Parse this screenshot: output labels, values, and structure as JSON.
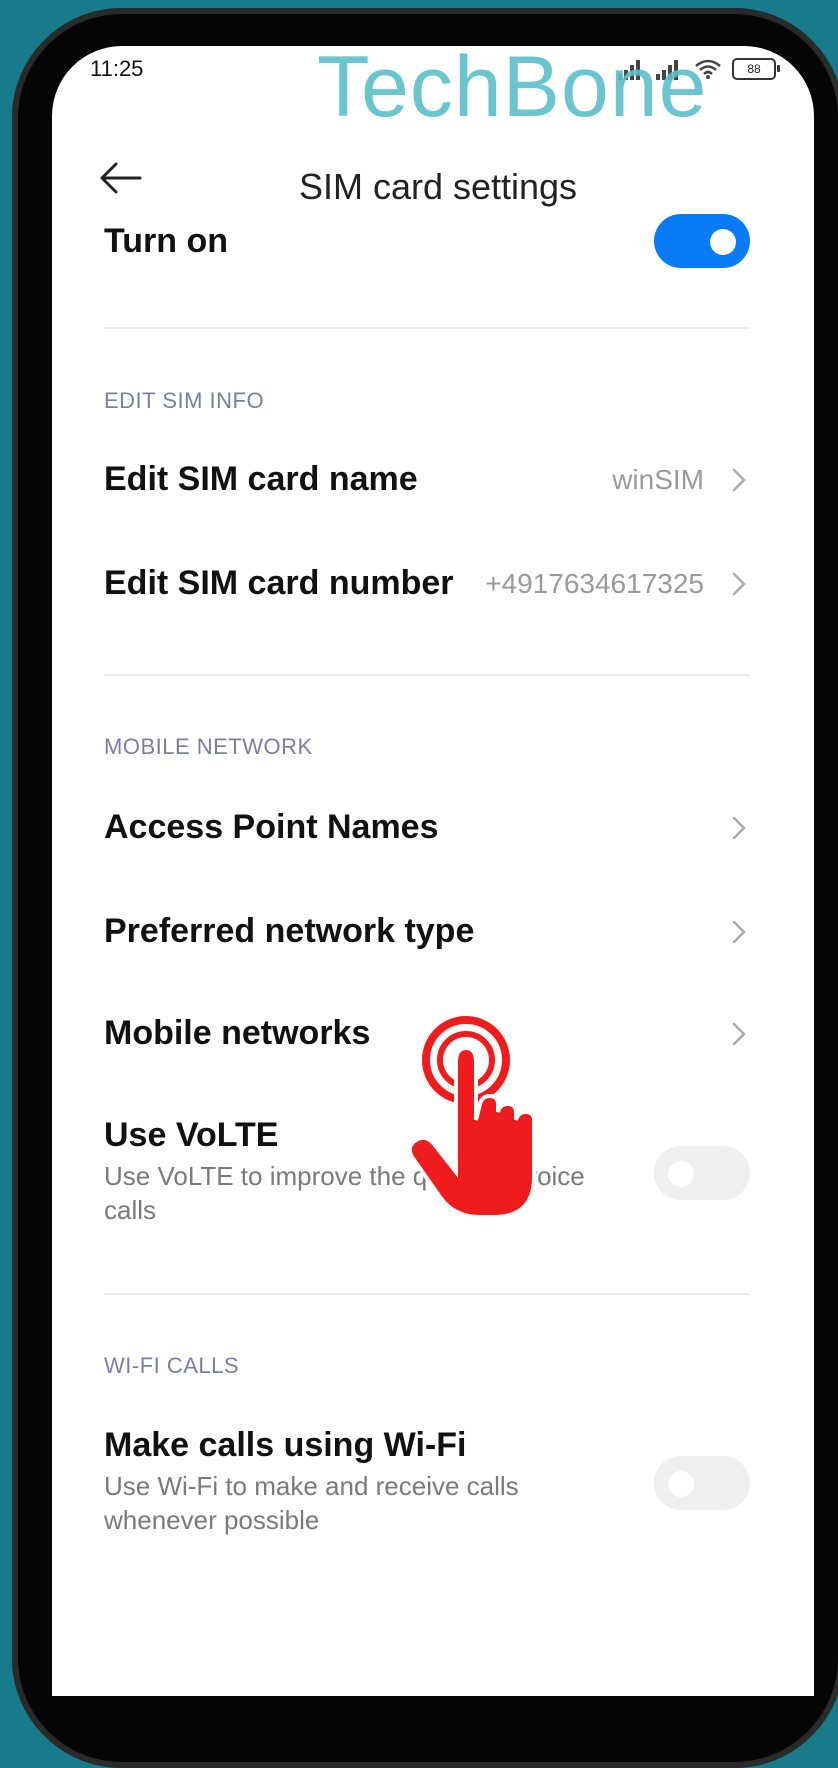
{
  "status_bar": {
    "time": "11:25",
    "battery": "88"
  },
  "watermark": "TechBone",
  "header": {
    "title": "SIM card settings"
  },
  "turn_on": {
    "label": "Turn on",
    "enabled": true
  },
  "sections": {
    "edit_sim_info": "EDIT SIM INFO",
    "mobile_network": "MOBILE NETWORK",
    "wifi_calls": "WI-FI CALLS"
  },
  "edit_sim_name": {
    "label": "Edit SIM card name",
    "value": "winSIM"
  },
  "edit_sim_number": {
    "label": "Edit SIM card number",
    "value": "+4917634617325"
  },
  "access_point_names": {
    "label": "Access Point Names"
  },
  "preferred_network_type": {
    "label": "Preferred network type"
  },
  "mobile_networks": {
    "label": "Mobile networks"
  },
  "volte": {
    "label": "Use VoLTE",
    "description": "Use VoLTE to improve the quality of voice calls",
    "enabled": false
  },
  "wifi_calling": {
    "label": "Make calls using Wi-Fi",
    "description": "Use Wi-Fi to make and receive calls whenever possible",
    "enabled": false
  },
  "colors": {
    "accent": "#0a7bf6",
    "section": "#7a7fa0",
    "tap_indicator": "#ee1c1c"
  }
}
